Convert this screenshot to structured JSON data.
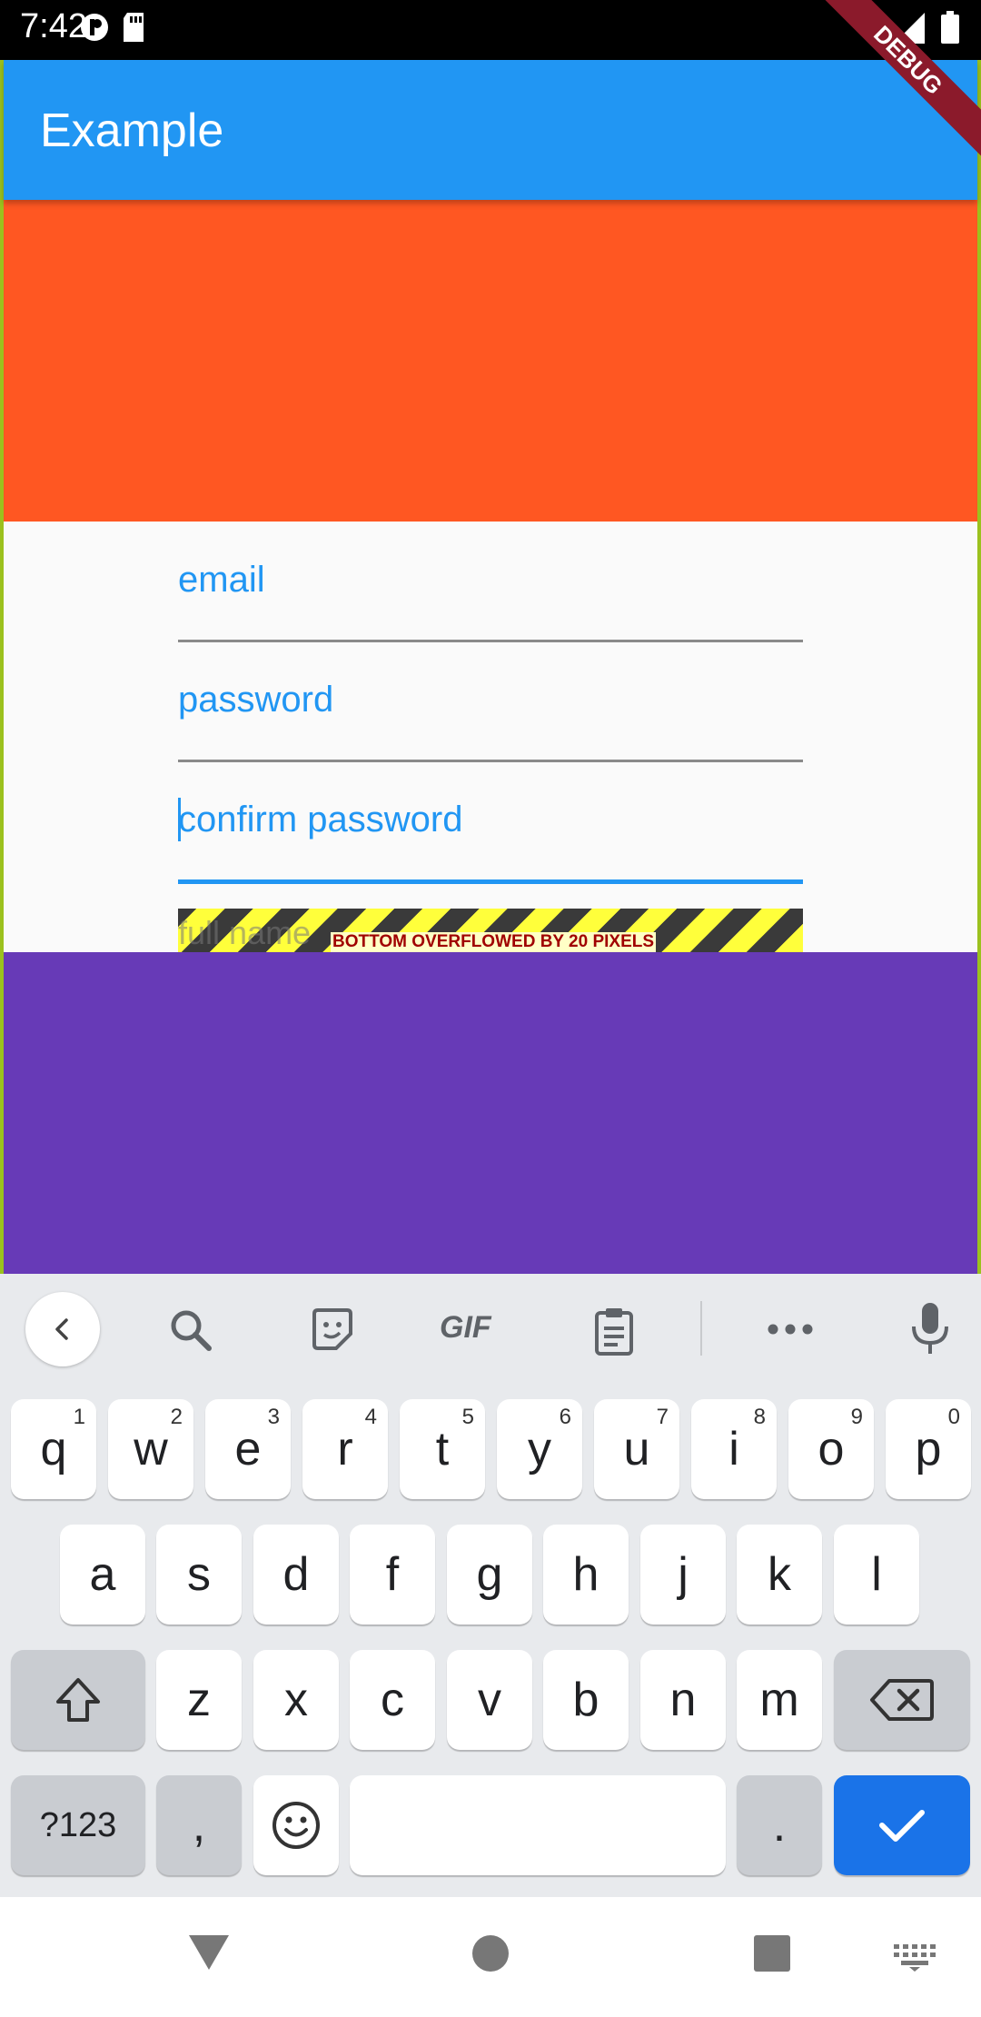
{
  "status_bar": {
    "time": "7:42"
  },
  "app_bar": {
    "title": "Example"
  },
  "debug_banner": "DEBUG",
  "form": {
    "email_label": "email",
    "password_label": "password",
    "confirm_label": "confirm password",
    "hidden_field_label": "full name",
    "overflow_warning": "BOTTOM OVERFLOWED BY 20 PIXELS"
  },
  "keyboard": {
    "toolbar": [
      "back-chevron-icon",
      "search-icon",
      "sticker-icon",
      "gif-icon",
      "clipboard-icon",
      "more-icon",
      "mic-icon"
    ],
    "gif_label": "GIF",
    "row1": [
      {
        "k": "q",
        "h": "1"
      },
      {
        "k": "w",
        "h": "2"
      },
      {
        "k": "e",
        "h": "3"
      },
      {
        "k": "r",
        "h": "4"
      },
      {
        "k": "t",
        "h": "5"
      },
      {
        "k": "y",
        "h": "6"
      },
      {
        "k": "u",
        "h": "7"
      },
      {
        "k": "i",
        "h": "8"
      },
      {
        "k": "o",
        "h": "9"
      },
      {
        "k": "p",
        "h": "0"
      }
    ],
    "row2": [
      "a",
      "s",
      "d",
      "f",
      "g",
      "h",
      "j",
      "k",
      "l"
    ],
    "row3": [
      "z",
      "x",
      "c",
      "v",
      "b",
      "n",
      "m"
    ],
    "symbols_label": "?123",
    "comma_label": ",",
    "period_label": "."
  },
  "colors": {
    "app_bar": "#2196F3",
    "orange": "#FF5722",
    "purple": "#673AB7",
    "accent": "#2196F3",
    "enter_key": "#1A73E8"
  }
}
